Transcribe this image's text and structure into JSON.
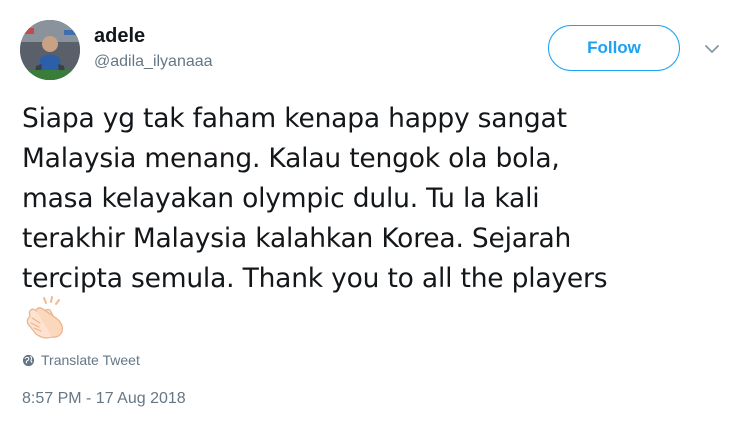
{
  "user": {
    "display_name": "adele",
    "handle": "@adila_ilyanaaa"
  },
  "follow_label": "Follow",
  "tweet": {
    "lines": [
      "Siapa yg tak faham kenapa happy sangat",
      "Malaysia menang. Kalau tengok ola bola,",
      "masa kelayakan olympic dulu. Tu la kali",
      "terakhir Malaysia kalahkan Korea. Sejarah",
      "tercipta semula. Thank you to all the players"
    ],
    "emoji": "clapping-hands-icon"
  },
  "translate_label": "Translate Tweet",
  "timestamp": "8:57 PM - 17 Aug 2018",
  "colors": {
    "accent": "#1da1f2",
    "secondary_text": "#657786",
    "primary_text": "#14171a"
  }
}
